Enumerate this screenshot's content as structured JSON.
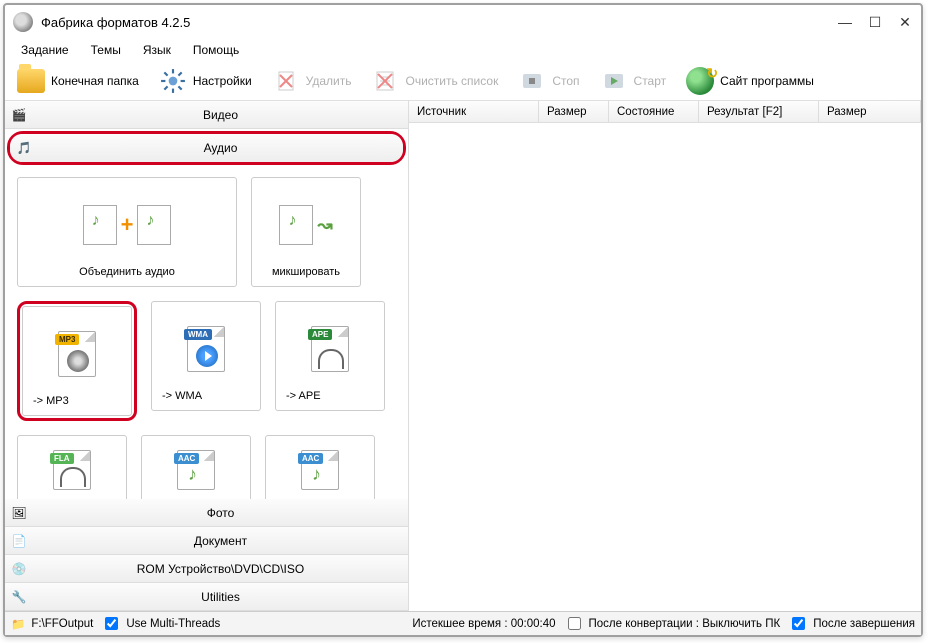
{
  "window": {
    "title": "Фабрика форматов 4.2.5"
  },
  "menu": {
    "task": "Задание",
    "themes": "Темы",
    "lang": "Язык",
    "help": "Помощь"
  },
  "toolbar": {
    "outputFolder": "Конечная папка",
    "settings": "Настройки",
    "delete": "Удалить",
    "clear": "Очистить список",
    "stop": "Стоп",
    "start": "Старт",
    "site": "Сайт программы"
  },
  "categories": {
    "video": "Видео",
    "audio": "Аудио",
    "photo": "Фото",
    "document": "Документ",
    "rom": "ROM Устройство\\DVD\\CD\\ISO",
    "utilities": "Utilities"
  },
  "tiles": {
    "joinAudio": "Объединить аудио",
    "mix": "микшировать",
    "mp3": "-> MP3",
    "wma": "-> WMA",
    "ape": "-> APE"
  },
  "columns": {
    "source": "Источник",
    "size": "Размер",
    "state": "Состояние",
    "result": "Результат [F2]",
    "size2": "Размер"
  },
  "status": {
    "outputPath": "F:\\FFOutput",
    "multiThreads": "Use Multi-Threads",
    "elapsed": "Истекшее время : 00:00:40",
    "afterConv": "После конвертации : Выключить ПК",
    "afterDone": "После завершения"
  }
}
